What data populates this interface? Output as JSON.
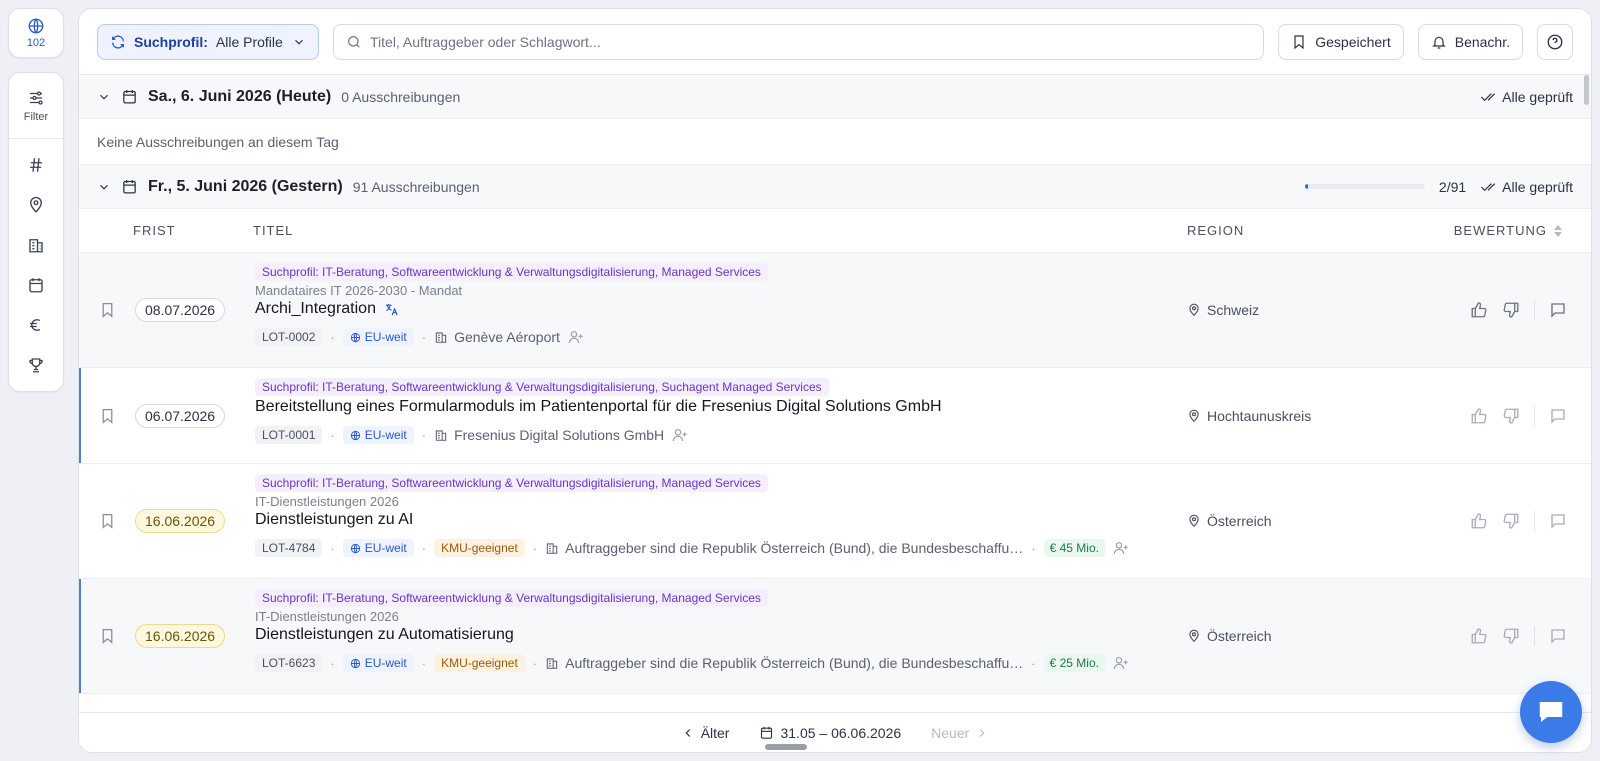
{
  "rail": {
    "globe_count": "102",
    "filter_label": "Filter",
    "tools": [
      "hash-icon",
      "location-icon",
      "building-icon",
      "calendar-icon",
      "euro-icon",
      "trophy-icon"
    ]
  },
  "toolbar": {
    "profile_prefix": "Suchprofil:",
    "profile_value": "Alle Profile",
    "search_placeholder": "Titel, Auftraggeber oder Schlagwort...",
    "saved_label": "Gespeichert",
    "notify_label": "Benachr."
  },
  "days": [
    {
      "title": "Sa., 6. Juni 2026 (Heute)",
      "count": "0 Ausschreibungen",
      "checked_label": "Alle geprüft",
      "empty_note": "Keine Ausschreibungen an diesem Tag"
    },
    {
      "title": "Fr., 5. Juni 2026 (Gestern)",
      "count": "91 Ausschreibungen",
      "progress_text": "2/91",
      "progress_fraction": 0.022,
      "checked_label": "Alle geprüft"
    }
  ],
  "columns": {
    "frist": "FRIST",
    "titel": "TITEL",
    "region": "REGION",
    "bewertung": "BEWERTUNG"
  },
  "rows": [
    {
      "date": "08.07.2026",
      "profile": "Suchprofil: IT-Beratung, Softwareentwicklung & Verwaltungsdigitalisierung, Managed Services",
      "subtitle": "Mandataires IT 2026-2030 - Mandat",
      "title": "Archi_Integration",
      "lot": "LOT-0002",
      "scope": "EU-weit",
      "org": "Genève Aéroport",
      "region": "Schweiz"
    },
    {
      "date": "06.07.2026",
      "profile": "Suchprofil: IT-Beratung, Softwareentwicklung & Verwaltungsdigitalisierung, Suchagent Managed Services",
      "title": "Bereitstellung eines Formularmoduls im Patientenportal für die Fresenius Digital Solutions GmbH",
      "lot": "LOT-0001",
      "scope": "EU-weit",
      "org": "Fresenius Digital Solutions GmbH",
      "region": "Hochtaunuskreis"
    },
    {
      "date": "16.06.2026",
      "profile": "Suchprofil: IT-Beratung, Softwareentwicklung & Verwaltungsdigitalisierung, Managed Services",
      "subtitle": "IT-Dienstleistungen 2026",
      "title": "Dienstleistungen zu AI",
      "lot": "LOT-4784",
      "scope": "EU-weit",
      "kmu": "KMU-geeignet",
      "org": "Auftraggeber sind die Republik Österreich (Bund), die Bundesbeschaffu…",
      "value": "€ 45 Mio.",
      "region": "Österreich"
    },
    {
      "date": "16.06.2026",
      "profile": "Suchprofil: IT-Beratung, Softwareentwicklung & Verwaltungsdigitalisierung, Managed Services",
      "subtitle": "IT-Dienstleistungen 2026",
      "title": "Dienstleistungen zu Automatisierung",
      "lot": "LOT-6623",
      "scope": "EU-weit",
      "kmu": "KMU-geeignet",
      "org": "Auftraggeber sind die Republik Österreich (Bund), die Bundesbeschaffu…",
      "value": "€ 25 Mio.",
      "region": "Österreich"
    }
  ],
  "footer": {
    "older": "Älter",
    "range": "31.05 – 06.06.2026",
    "newer": "Neuer"
  }
}
